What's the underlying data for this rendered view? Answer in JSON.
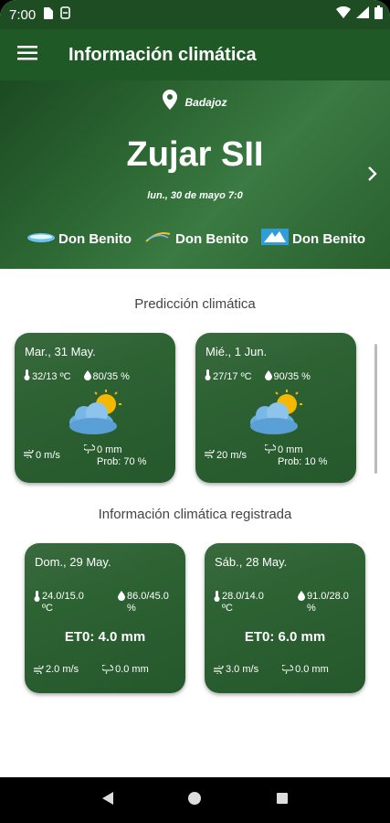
{
  "status_bar": {
    "time": "7:00"
  },
  "app_bar": {
    "title": "Información climática"
  },
  "header": {
    "location": "Badajoz",
    "station": "Zujar SII",
    "datetime": "lun., 30 de mayo 7:0",
    "logos": [
      {
        "label": "Don Benito"
      },
      {
        "label": "Don Benito"
      },
      {
        "label": "Don Benito"
      }
    ]
  },
  "prediction": {
    "title": "Predicción climática",
    "cards": [
      {
        "date": "Mar., 31 May.",
        "temp": "32/13 ºC",
        "humidity": "80/35 %",
        "wind": "0 m/s",
        "precip": "0 mm",
        "prob": "Prob: 70 %"
      },
      {
        "date": "Mié., 1 Jun.",
        "temp": "27/17 ºC",
        "humidity": "90/35 %",
        "wind": "20 m/s",
        "precip": "0 mm",
        "prob": "Prob: 10 %"
      }
    ]
  },
  "registered": {
    "title": "Información climática registrada",
    "cards": [
      {
        "date": "Dom., 29 May.",
        "temp": "24.0/15.0 ºC",
        "humidity": "86.0/45.0 %",
        "eto": "ET0: 4.0 mm",
        "wind": "2.0 m/s",
        "precip": "0.0 mm"
      },
      {
        "date": "Sáb., 28 May.",
        "temp": "28.0/14.0 ºC",
        "humidity": "91.0/28.0 %",
        "eto": "ET0: 6.0 mm",
        "wind": "3.0 m/s",
        "precip": "0.0 mm"
      }
    ]
  },
  "colors": {
    "primary": "#1f5a26",
    "card": "#2d6233",
    "sun": "#f5b800",
    "cloud": "#5aa4d8"
  }
}
